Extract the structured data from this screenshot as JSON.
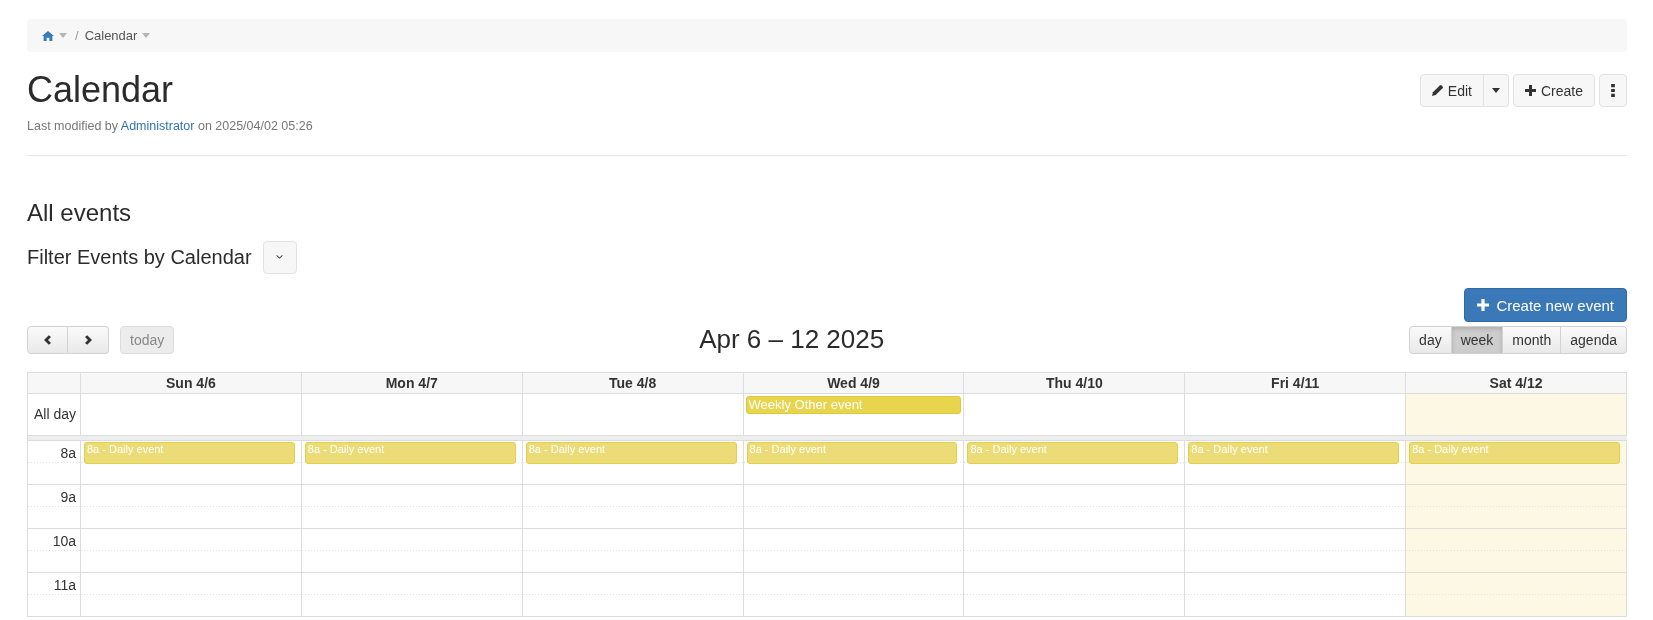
{
  "breadcrumb": {
    "separator": "/",
    "items": [
      {
        "kind": "home",
        "dropdown": true
      },
      {
        "kind": "page",
        "label": "Calendar",
        "dropdown": true
      }
    ]
  },
  "header": {
    "title": "Calendar",
    "modified": {
      "prefix": "Last modified by",
      "author": "Administrator",
      "suffix": "on 2025/04/02 05:26"
    },
    "actions": [
      {
        "kind": "edit",
        "label": "Edit"
      },
      {
        "kind": "create",
        "label": "Create"
      },
      {
        "kind": "more"
      }
    ]
  },
  "events_section": {
    "title": "All events",
    "filter_label": "Filter Events by Calendar",
    "create_button": "Create new event"
  },
  "toolbar": {
    "today": {
      "label": "today",
      "disabled": true
    },
    "title": "Apr 6 – 12 2025",
    "views": [
      {
        "label": "day",
        "selected": false
      },
      {
        "label": "week",
        "selected": true
      },
      {
        "label": "month",
        "selected": false
      },
      {
        "label": "agenda",
        "selected": false
      }
    ]
  },
  "calendar": {
    "days": [
      {
        "label": "Sun 4/6",
        "today": false
      },
      {
        "label": "Mon 4/7",
        "today": false
      },
      {
        "label": "Tue 4/8",
        "today": false
      },
      {
        "label": "Wed 4/9",
        "today": false
      },
      {
        "label": "Thu 4/10",
        "today": false
      },
      {
        "label": "Fri 4/11",
        "today": false
      },
      {
        "label": "Sat 4/12",
        "today": true
      }
    ],
    "all_day": {
      "label": "All day",
      "cells": [
        {},
        {},
        {},
        {
          "events": [
            {
              "text": "Weekly Other event",
              "color": "#e8d44d"
            }
          ]
        },
        {},
        {},
        {}
      ]
    },
    "hours": [
      {
        "label": "8a",
        "cells": [
          {
            "events": [
              {
                "text": "8a - Daily event",
                "color": "#ecdc78"
              }
            ]
          },
          {
            "events": [
              {
                "text": "8a - Daily event",
                "color": "#ecdc78"
              }
            ]
          },
          {
            "events": [
              {
                "text": "8a - Daily event",
                "color": "#ecdc78"
              }
            ]
          },
          {
            "events": [
              {
                "text": "8a - Daily event",
                "color": "#ecdc78"
              }
            ]
          },
          {
            "events": [
              {
                "text": "8a - Daily event",
                "color": "#ecdc78"
              }
            ]
          },
          {
            "events": [
              {
                "text": "8a - Daily event",
                "color": "#ecdc78"
              }
            ]
          },
          {
            "events": [
              {
                "text": "8a - Daily event",
                "color": "#ecdc78"
              }
            ]
          }
        ]
      },
      {
        "label": "9a"
      },
      {
        "label": "10a"
      },
      {
        "label": "11a"
      }
    ]
  }
}
